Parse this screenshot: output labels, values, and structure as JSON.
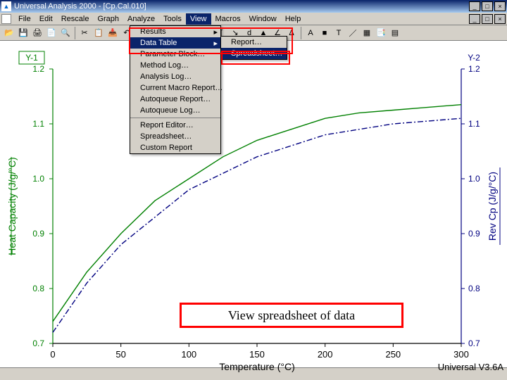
{
  "app": {
    "title": "Universal Analysis 2000 - [Cp.Cal.010]",
    "icon_name": "app-icon"
  },
  "window_controls": {
    "min": "_",
    "max": "□",
    "close": "×"
  },
  "menubar": {
    "items": [
      {
        "label": "File"
      },
      {
        "label": "Edit"
      },
      {
        "label": "Rescale"
      },
      {
        "label": "Graph"
      },
      {
        "label": "Analyze"
      },
      {
        "label": "Tools"
      },
      {
        "label": "View",
        "highlight": true
      },
      {
        "label": "Macros"
      },
      {
        "label": "Window"
      },
      {
        "label": "Help"
      }
    ]
  },
  "view_menu": {
    "items": [
      {
        "label": "Results",
        "submenu": true
      },
      {
        "label": "Data Table",
        "submenu": true,
        "highlight": true
      },
      {
        "label": "Parameter Block…"
      },
      {
        "label": "Method Log…"
      },
      {
        "label": "Analysis Log…"
      },
      {
        "label": "Current Macro Report…"
      },
      {
        "label": "Autoqueue Report…"
      },
      {
        "label": "Autoqueue Log…"
      },
      {
        "label": "Report Editor…",
        "sep": true
      },
      {
        "label": "Spreadsheet…"
      },
      {
        "label": "Custom Report"
      }
    ],
    "submenu_items": [
      {
        "label": "Report…"
      },
      {
        "label": "Spreadsheet…",
        "highlight": true
      }
    ]
  },
  "toolbar_icons": [
    "open",
    "save",
    "print1",
    "print2",
    "preview",
    "cut",
    "copy",
    "paste",
    "undo",
    "zoom-in",
    "zoom-out",
    "fit",
    "fullscale",
    "legend",
    "integral",
    "onset",
    "deriv",
    "peak",
    "tangent",
    "enthalpy",
    "auto",
    "stop",
    "text",
    "line-tool",
    "data-table",
    "report",
    "spreadsheet"
  ],
  "annotation": {
    "text": "View spreadsheet of data"
  },
  "axis_labels": {
    "y1": "Y-1",
    "y2": "Y-2",
    "yleft": "Heat Capacity (J/g/°C)",
    "yright": "Rev Cp (J/g/°C)",
    "x": "Temperature (°C)",
    "brand": "Universal V3.6A"
  },
  "chart_data": {
    "type": "line",
    "xlabel": "Temperature (°C)",
    "xlim": [
      0,
      300
    ],
    "xticks": [
      0,
      50,
      100,
      150,
      200,
      250,
      300
    ],
    "left_axis": {
      "label": "Heat Capacity (J/g/°C)",
      "lim": [
        0.7,
        1.2
      ],
      "ticks": [
        0.7,
        0.8,
        0.9,
        1.0,
        1.1,
        1.2
      ],
      "marker": "Y-1"
    },
    "right_axis": {
      "label": "Rev Cp (J/g/°C)",
      "lim": [
        0.7,
        1.2
      ],
      "ticks": [
        0.7,
        0.8,
        0.9,
        1.0,
        1.1,
        1.2
      ],
      "marker": "Y-2"
    },
    "series": [
      {
        "name": "Heat Capacity (Y-1)",
        "axis": "left",
        "color": "#008000",
        "x": [
          0,
          25,
          50,
          75,
          100,
          125,
          150,
          175,
          200,
          225,
          250,
          275,
          300
        ],
        "values": [
          0.74,
          0.83,
          0.9,
          0.96,
          1.0,
          1.04,
          1.07,
          1.09,
          1.11,
          1.12,
          1.125,
          1.13,
          1.135
        ]
      },
      {
        "name": "Rev Cp (Y-2)",
        "axis": "right",
        "color": "#000080",
        "style": "dash-dot",
        "x": [
          0,
          25,
          50,
          75,
          100,
          125,
          150,
          175,
          200,
          225,
          250,
          275,
          300
        ],
        "values": [
          0.72,
          0.81,
          0.88,
          0.93,
          0.98,
          1.01,
          1.04,
          1.06,
          1.08,
          1.09,
          1.1,
          1.105,
          1.11
        ]
      }
    ],
    "brand": "Universal V3.6A"
  }
}
